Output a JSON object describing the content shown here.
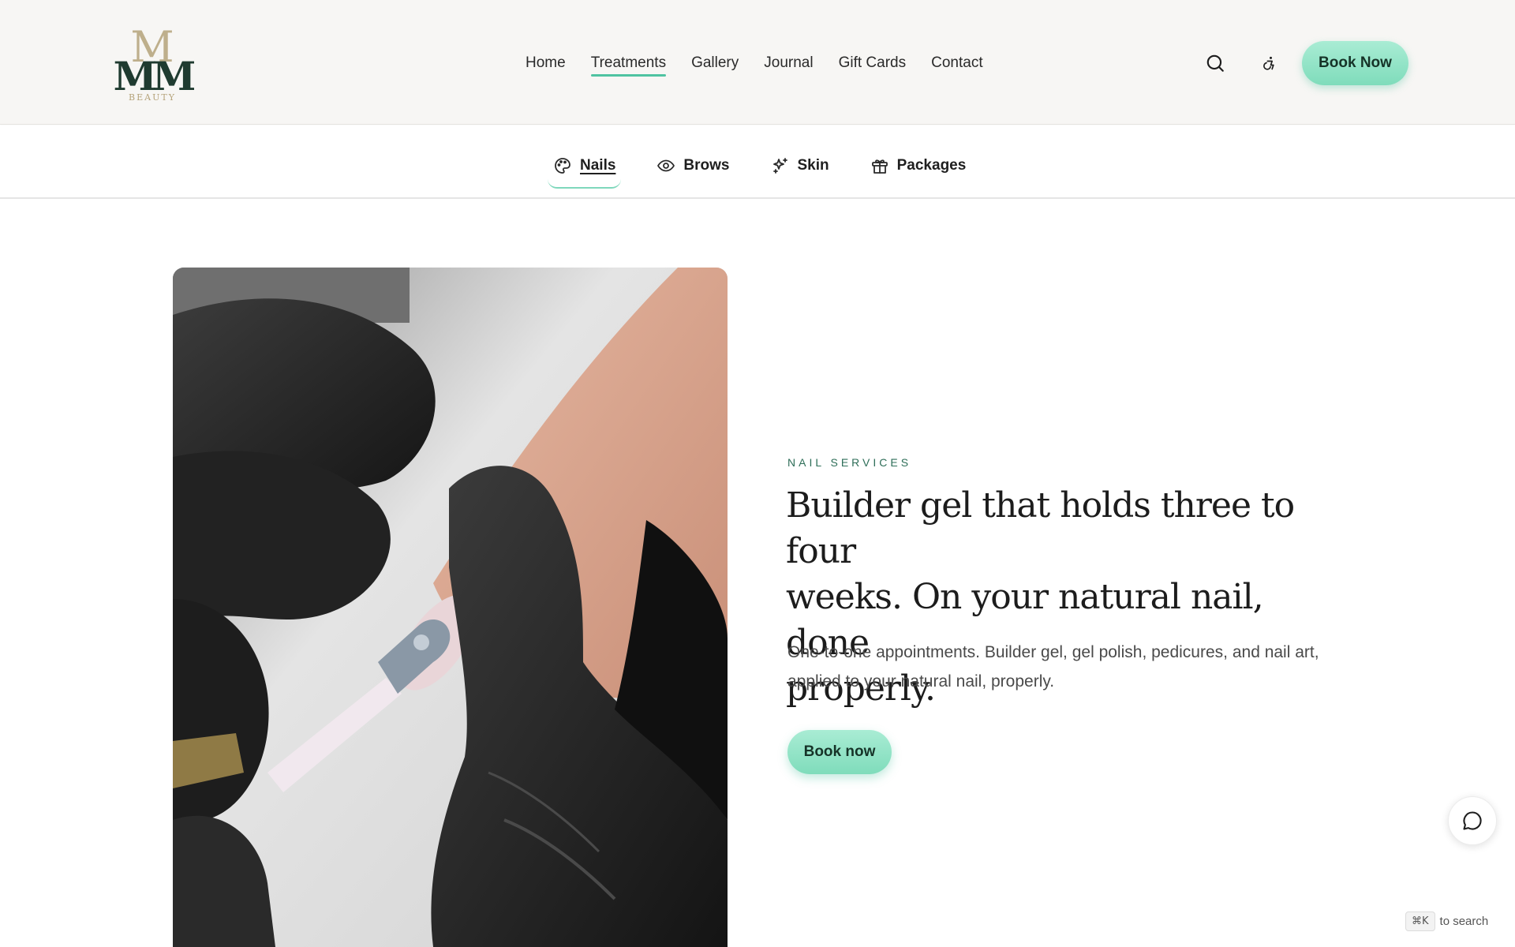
{
  "brand": {
    "logo_letter_top": "M",
    "logo_letters": "MM",
    "logo_subtext": "BEAUTY",
    "colors": {
      "accent": "#7fdcbb",
      "logo_gold": "#b5a37a",
      "logo_green": "#1f3b30",
      "eyebrow": "#2e6e58"
    }
  },
  "nav": {
    "items": [
      {
        "label": "Home",
        "active": false
      },
      {
        "label": "Treatments",
        "active": true
      },
      {
        "label": "Gallery",
        "active": false
      },
      {
        "label": "Journal",
        "active": false
      },
      {
        "label": "Gift Cards",
        "active": false
      },
      {
        "label": "Contact",
        "active": false
      }
    ],
    "search_icon": "search-icon",
    "accessibility_icon": "accessibility-icon",
    "book_label": "Book Now"
  },
  "subnav": {
    "tabs": [
      {
        "label": "Nails",
        "icon": "palette-icon",
        "active": true
      },
      {
        "label": "Brows",
        "icon": "eye-icon",
        "active": false
      },
      {
        "label": "Skin",
        "icon": "sparkles-icon",
        "active": false
      },
      {
        "label": "Packages",
        "icon": "gift-icon",
        "active": false
      }
    ]
  },
  "hero": {
    "eyebrow": "NAIL SERVICES",
    "headline_lines": [
      "Builder gel that holds three to four",
      "weeks. On your natural nail, done",
      "properly."
    ],
    "description": "One-to-one appointments. Builder gel, gel polish, pedicures, and nail art, applied to your natural nail, properly.",
    "cta_label": "Book now",
    "image_icon": "nail-application-photo"
  },
  "floating": {
    "chat_icon": "chat-bubble-icon",
    "shortcut_key": "⌘K",
    "shortcut_text": "to search"
  }
}
